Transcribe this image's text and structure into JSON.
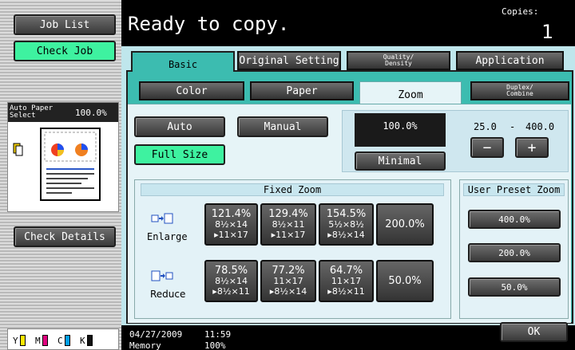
{
  "sidebar": {
    "job_list": "Job List",
    "check_job": "Check Job",
    "paper_label_1": "Auto Paper",
    "paper_label_2": "Select",
    "paper_pct": "100.0%",
    "check_details": "Check Details",
    "toner": [
      "Y",
      "M",
      "C",
      "K"
    ]
  },
  "header": {
    "status": "Ready to copy.",
    "copies_label": "Copies:",
    "copies_value": "1"
  },
  "tabs": {
    "basic": "Basic",
    "original_setting": "Original Setting",
    "quality_1": "Quality/",
    "quality_2": "Density",
    "application": "Application"
  },
  "subtabs": {
    "color": "Color",
    "paper": "Paper",
    "zoom": "Zoom",
    "duplex_1": "Duplex/",
    "duplex_2": "Combine"
  },
  "zoom": {
    "auto": "Auto",
    "manual": "Manual",
    "full_size": "Full Size",
    "display": "100.0%",
    "minimal": "Minimal",
    "range_min": "25.0",
    "range_dash": "-",
    "range_max": "400.0",
    "minus": "−",
    "plus": "+"
  },
  "fixed": {
    "title": "Fixed Zoom",
    "enlarge": "Enlarge",
    "reduce": "Reduce",
    "enlarge_items": [
      {
        "pct": "121.4%",
        "l1": "8½×14",
        "l2": "▸11×17"
      },
      {
        "pct": "129.4%",
        "l1": "8½×11",
        "l2": "▸11×17"
      },
      {
        "pct": "154.5%",
        "l1": "5½×8½",
        "l2": "▸8½×14"
      },
      {
        "pct": "200.0%"
      }
    ],
    "reduce_items": [
      {
        "pct": "78.5%",
        "l1": "8½×14",
        "l2": "▸8½×11"
      },
      {
        "pct": "77.2%",
        "l1": "11×17",
        "l2": "▸8½×14"
      },
      {
        "pct": "64.7%",
        "l1": "11×17",
        "l2": "▸8½×11"
      },
      {
        "pct": "50.0%"
      }
    ]
  },
  "preset": {
    "title": "User Preset Zoom",
    "items": [
      "400.0%",
      "200.0%",
      "50.0%"
    ]
  },
  "footer": {
    "date": "04/27/2009",
    "time": "11:59",
    "memory_label": "Memory",
    "memory_value": "100%",
    "ok": "OK"
  }
}
